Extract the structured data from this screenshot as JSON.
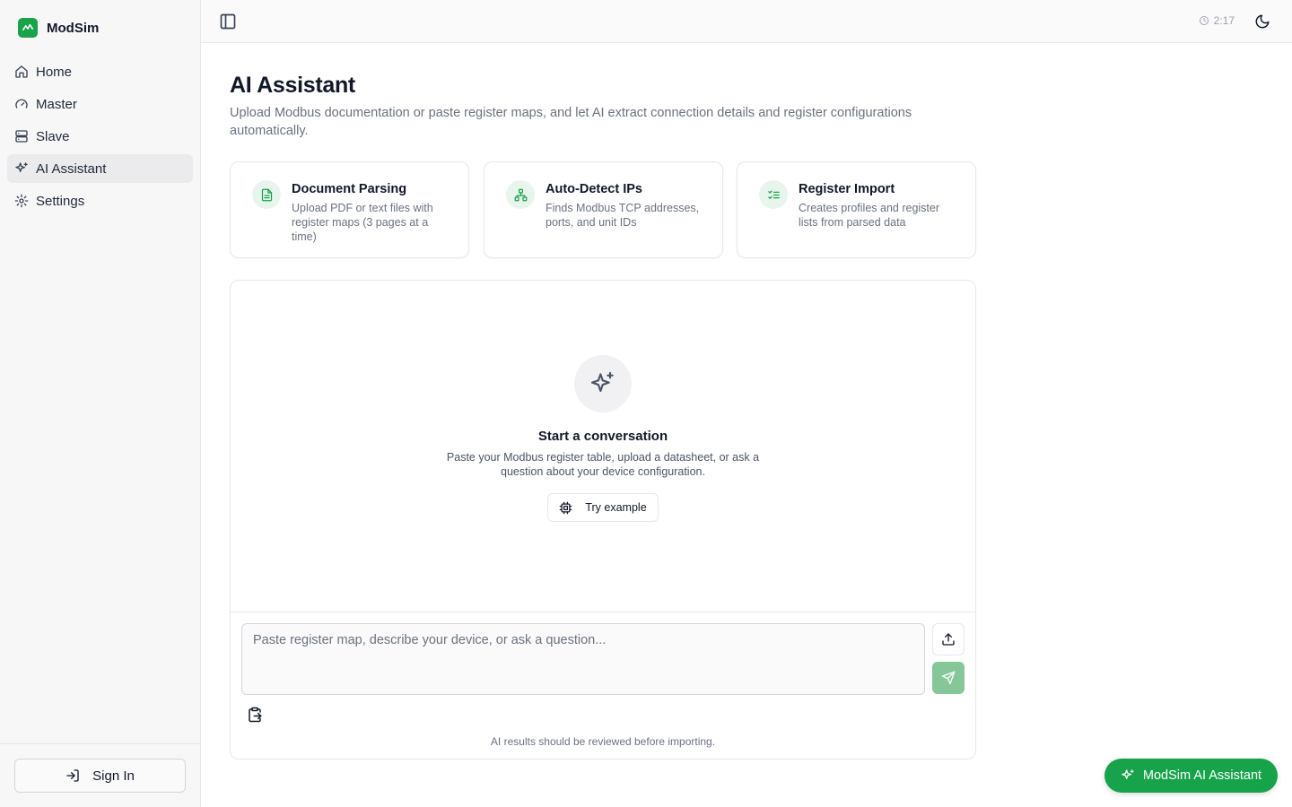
{
  "app": {
    "name": "ModSim"
  },
  "sidebar": {
    "items": [
      {
        "label": "Home",
        "icon": "home-icon"
      },
      {
        "label": "Master",
        "icon": "gauge-icon"
      },
      {
        "label": "Slave",
        "icon": "server-icon"
      },
      {
        "label": "AI Assistant",
        "icon": "sparkles-icon",
        "active": true
      },
      {
        "label": "Settings",
        "icon": "gear-icon"
      }
    ],
    "sign_in_label": "Sign In"
  },
  "topbar": {
    "time": "2:17"
  },
  "main": {
    "title": "AI Assistant",
    "description": "Upload Modbus documentation or paste register maps, and let AI extract connection details and register configurations automatically.",
    "features": [
      {
        "title": "Document Parsing",
        "description": "Upload PDF or text files with register maps (3 pages at a time)",
        "icon": "file-text-icon"
      },
      {
        "title": "Auto-Detect IPs",
        "description": "Finds Modbus TCP addresses, ports, and unit IDs",
        "icon": "network-icon"
      },
      {
        "title": "Register Import",
        "description": "Creates profiles and register lists from parsed data",
        "icon": "list-checks-icon"
      }
    ]
  },
  "chat": {
    "empty_title": "Start a conversation",
    "empty_description": "Paste your Modbus register table, upload a datasheet, or ask a question about your device configuration.",
    "try_example_label": "Try example",
    "input_placeholder": "Paste register map, describe your device, or ask a question...",
    "disclaimer": "AI results should be reviewed before importing."
  },
  "fab": {
    "label": "ModSim AI Assistant"
  },
  "colors": {
    "accent": "#16a34a",
    "send_disabled": "#86c79a",
    "active_nav_bg": "#ebebed"
  }
}
